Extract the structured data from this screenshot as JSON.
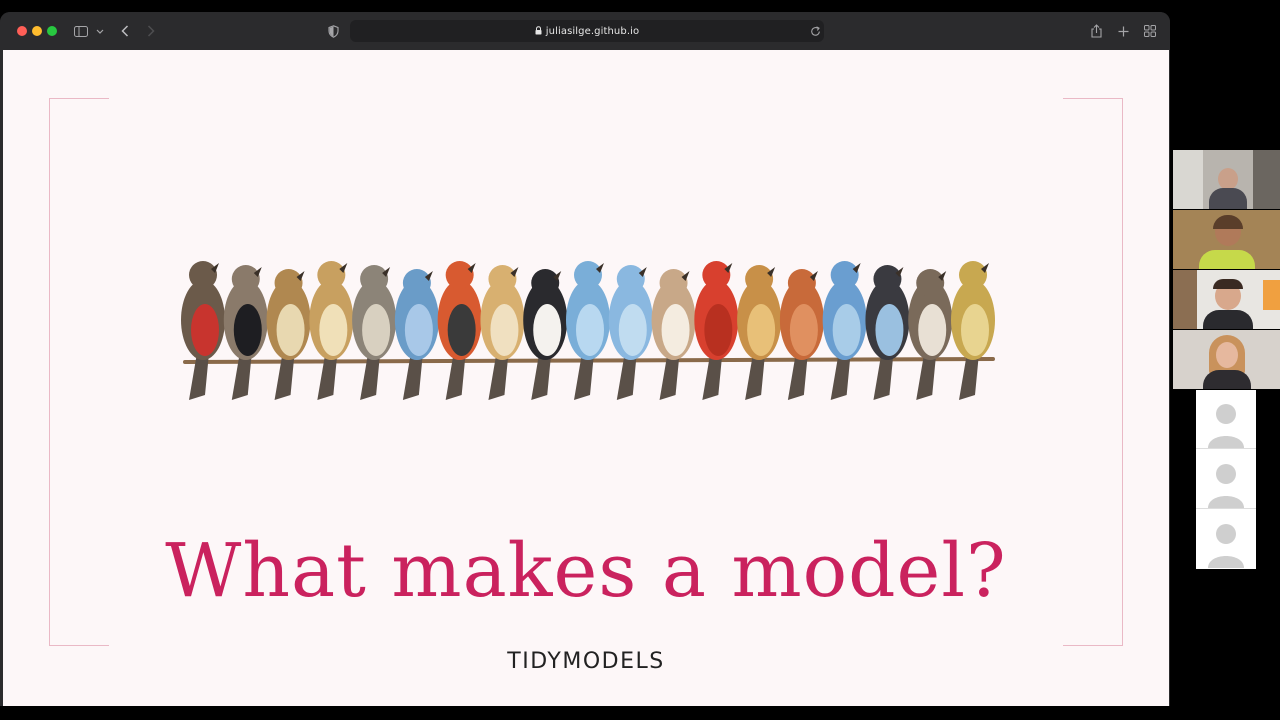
{
  "browser": {
    "url": "juliasilge.github.io",
    "icons": [
      "sidebar-icon",
      "chevron-down-icon",
      "back-icon",
      "forward-icon",
      "shield-icon",
      "lock-icon",
      "reload-icon",
      "share-icon",
      "new-tab-icon",
      "tab-overview-icon"
    ]
  },
  "slide": {
    "title": "What makes a model?",
    "subtitle": "TIDYMODELS",
    "accent_color": "#ca225e",
    "background_color": "#fdf7f8",
    "frame_color": "#eab9c6",
    "image": "birds-on-branch-illustration"
  },
  "meeting": {
    "video_participants": 4,
    "avatar_participants": 3
  }
}
